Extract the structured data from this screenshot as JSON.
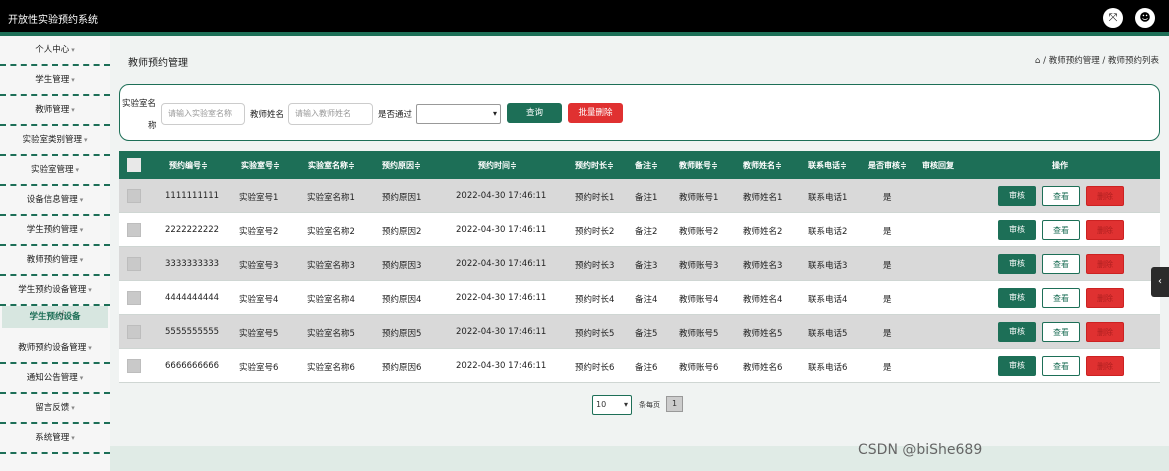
{
  "app": {
    "title": "开放性实验预约系统"
  },
  "topbar_icons": [
    "expand-icon",
    "user-icon"
  ],
  "sidebar": {
    "items": [
      {
        "label": "个人中心"
      },
      {
        "label": "学生管理"
      },
      {
        "label": "教师管理"
      },
      {
        "label": "实验室类别管理"
      },
      {
        "label": "实验室管理"
      },
      {
        "label": "设备信息管理"
      },
      {
        "label": "学生预约管理"
      },
      {
        "label": "教师预约管理"
      },
      {
        "label": "学生预约设备管理"
      },
      {
        "label": "教师预约设备管理"
      },
      {
        "label": "通知公告管理"
      },
      {
        "label": "留言反馈"
      },
      {
        "label": "系统管理"
      }
    ],
    "sub_active": "学生预约设备",
    "caret": "▾"
  },
  "page": {
    "title": "教师预约管理",
    "breadcrumb": "/ 教师预约管理 / 教师预约列表"
  },
  "search": {
    "lab_name_label_1": "实验室名",
    "lab_name_label_2": "称",
    "lab_name_placeholder": "请输入实验室名称",
    "teacher_label": "教师姓名",
    "teacher_placeholder": "请输入教师姓名",
    "passed_label": "是否通过",
    "passed_value": "",
    "query_button": "查询",
    "batch_delete_button": "批量删除"
  },
  "table": {
    "headers": [
      "预约编号≑",
      "实验室号≑",
      "实验室名称≑",
      "预约原因≑",
      "预约时间≑",
      "预约时长≑",
      "备注≑",
      "教师账号≑",
      "教师姓名≑",
      "联系电话≑",
      "是否审核≑",
      "审核回复",
      "操作"
    ],
    "rows": [
      [
        "1111111111",
        "实验室号1",
        "实验室名称1",
        "预约原因1",
        "2022-04-30 17:46:11",
        "预约时长1",
        "备注1",
        "教师账号1",
        "教师姓名1",
        "联系电话1",
        "是",
        ""
      ],
      [
        "2222222222",
        "实验室号2",
        "实验室名称2",
        "预约原因2",
        "2022-04-30 17:46:11",
        "预约时长2",
        "备注2",
        "教师账号2",
        "教师姓名2",
        "联系电话2",
        "是",
        ""
      ],
      [
        "3333333333",
        "实验室号3",
        "实验室名称3",
        "预约原因3",
        "2022-04-30 17:46:11",
        "预约时长3",
        "备注3",
        "教师账号3",
        "教师姓名3",
        "联系电话3",
        "是",
        ""
      ],
      [
        "4444444444",
        "实验室号4",
        "实验室名称4",
        "预约原因4",
        "2022-04-30 17:46:11",
        "预约时长4",
        "备注4",
        "教师账号4",
        "教师姓名4",
        "联系电话4",
        "是",
        ""
      ],
      [
        "5555555555",
        "实验室号5",
        "实验室名称5",
        "预约原因5",
        "2022-04-30 17:46:11",
        "预约时长5",
        "备注5",
        "教师账号5",
        "教师姓名5",
        "联系电话5",
        "是",
        ""
      ],
      [
        "6666666666",
        "实验室号6",
        "实验室名称6",
        "预约原因6",
        "2022-04-30 17:46:11",
        "预约时长6",
        "备注6",
        "教师账号6",
        "教师姓名6",
        "联系电话6",
        "是",
        ""
      ]
    ],
    "actions": {
      "audit": "审核",
      "view": "查看",
      "delete": "删除"
    }
  },
  "pagination": {
    "page_size": "10",
    "per_page_label": "条每页",
    "current_page": "1"
  },
  "watermark": "CSDN @biShe689",
  "colors": {
    "accent": "#1d6f57",
    "danger": "#e03131",
    "topbar": "#000000"
  }
}
